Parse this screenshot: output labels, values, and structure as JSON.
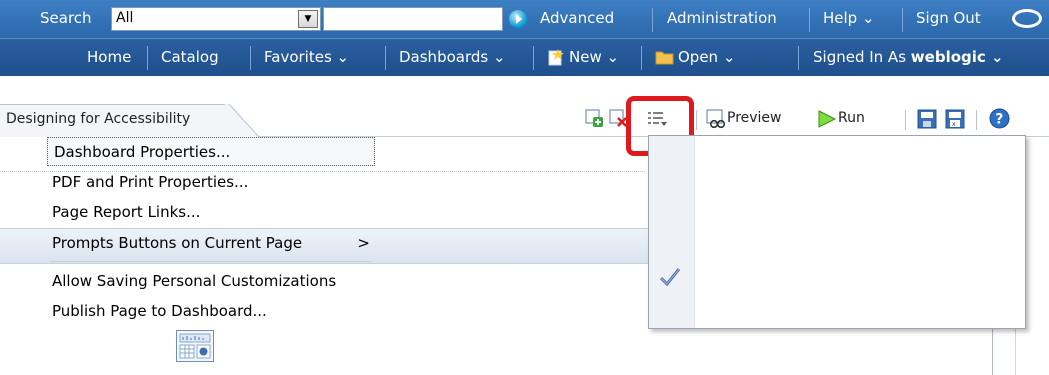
{
  "search": {
    "label": "Search",
    "scope_value": "All",
    "query_value": ""
  },
  "topnav": {
    "advanced": "Advanced",
    "administration": "Administration",
    "help": "Help ⌄",
    "signout": "Sign Out"
  },
  "secondnav": {
    "home": "Home",
    "catalog": "Catalog",
    "favorites": "Favorites ⌄",
    "dashboards": "Dashboards ⌄",
    "new": "New ⌄",
    "open": "Open ⌄",
    "signed_in_label": "Signed In As",
    "user": "weblogic ⌄"
  },
  "tab": {
    "label": "Designing for Accessibility"
  },
  "toolbar": {
    "preview": "Preview",
    "run": "Run"
  },
  "menu": {
    "items": [
      {
        "label": "Dashboard Properties..."
      },
      {
        "label": "PDF and Print Properties..."
      },
      {
        "label": "Page Report Links..."
      },
      {
        "label": "Prompts Buttons on Current Page",
        "submenu": ">"
      },
      {
        "label": "Allow Saving Personal Customizations",
        "checked": true
      },
      {
        "label": "Publish Page to Dashboard..."
      }
    ]
  },
  "colors": {
    "header_top": "#3e7fc4",
    "header_bottom": "#1f4f8c",
    "highlight": "#e0191f"
  }
}
